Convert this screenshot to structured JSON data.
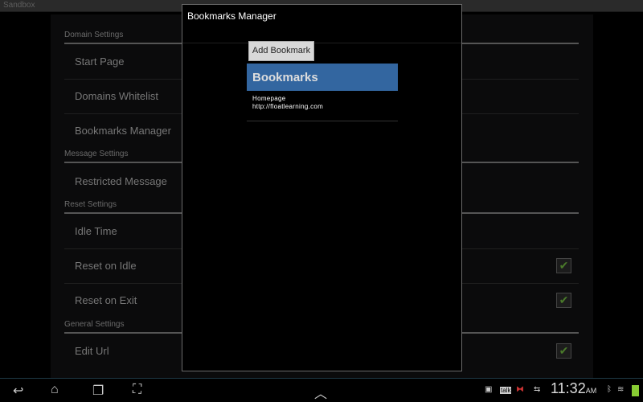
{
  "app": {
    "title": "Sandbox"
  },
  "settings": {
    "domain_header": "Domain Settings",
    "start_page": "Start Page",
    "domains_whitelist": "Domains Whitelist",
    "bookmarks_manager": "Bookmarks Manager",
    "message_header": "Message Settings",
    "restricted_message": "Restricted Message",
    "reset_header": "Reset Settings",
    "idle_time": "Idle Time",
    "reset_on_idle": "Reset on Idle",
    "reset_on_exit": "Reset on Exit",
    "general_header": "General Settings",
    "edit_url": "Edit Url",
    "checkmark": "✔"
  },
  "dialog": {
    "title": "Bookmarks Manager",
    "add_button": "Add Bookmark",
    "list_header": "Bookmarks",
    "bookmarks": [
      {
        "name": "Homepage",
        "url": "http://floatlearning.com"
      }
    ]
  },
  "statusbar": {
    "time": "11:32",
    "ampm": "AM",
    "talk": "talk"
  },
  "colors": {
    "accent": "#3366a0",
    "check": "#4a7a2a"
  }
}
